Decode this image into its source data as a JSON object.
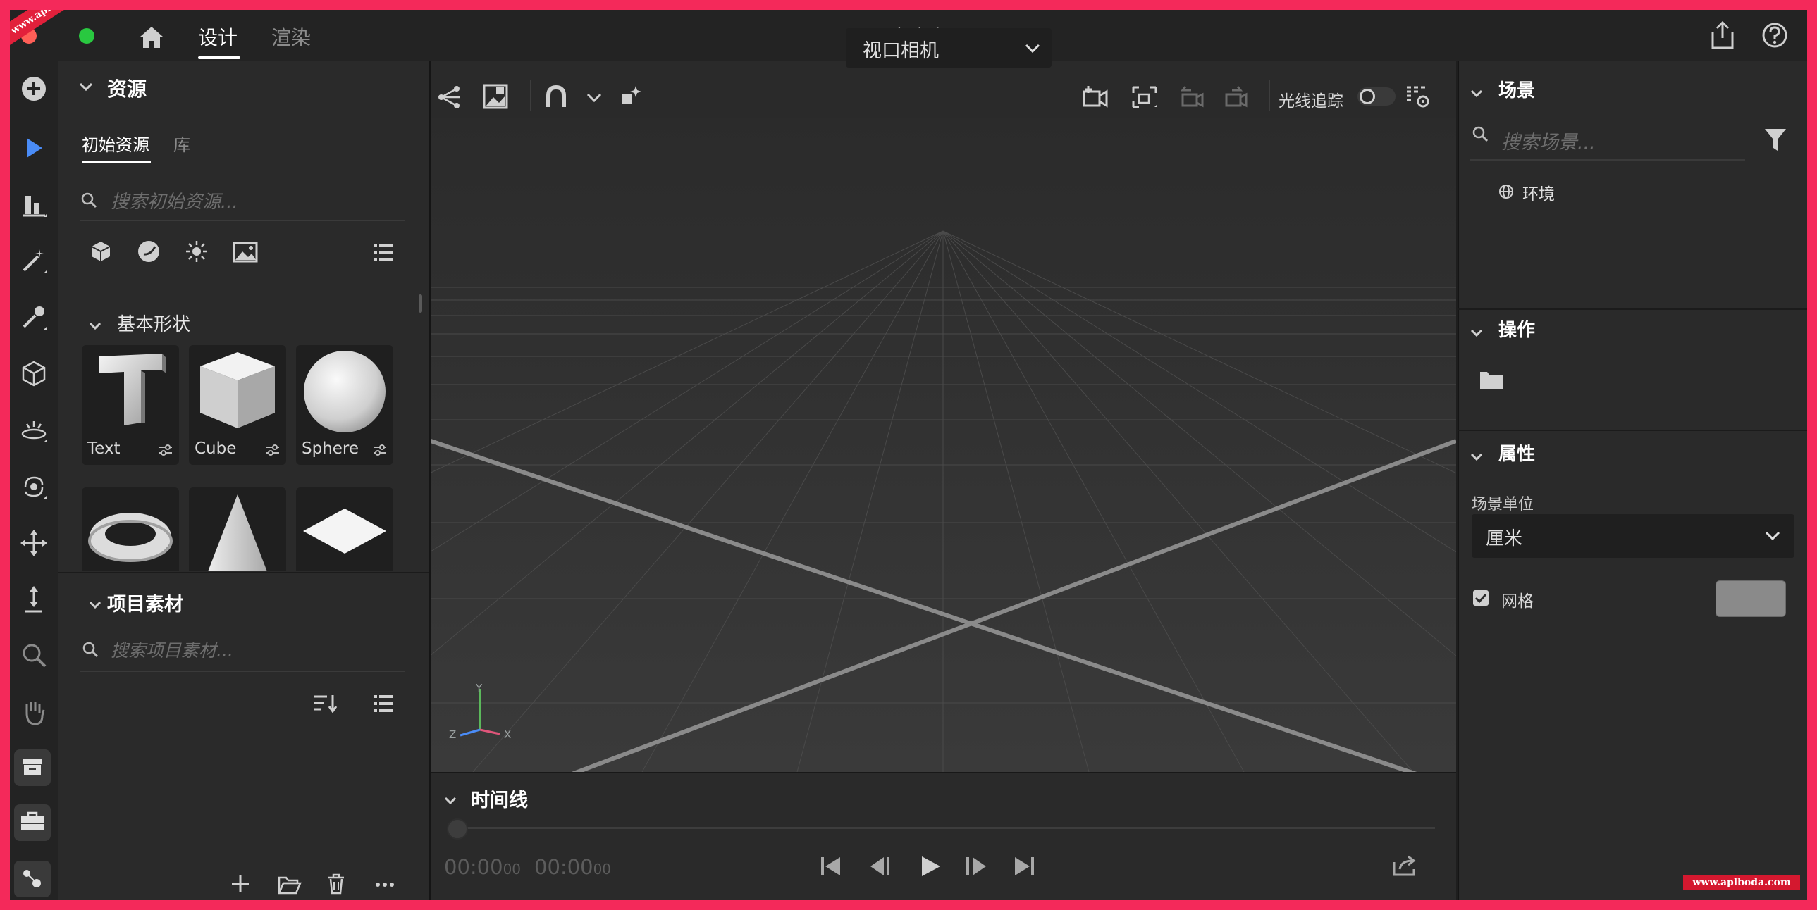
{
  "app": {
    "document_title": "未命名"
  },
  "header": {
    "tabs": [
      {
        "label": "设计",
        "active": true
      },
      {
        "label": "渲染",
        "active": false
      }
    ]
  },
  "assets_panel": {
    "title": "资源",
    "sub_tabs": [
      {
        "label": "初始资源",
        "active": true
      },
      {
        "label": "库",
        "active": false
      }
    ],
    "search_placeholder": "搜索初始资源...",
    "basic_shapes_title": "基本形状",
    "shapes": [
      {
        "label": "Text",
        "icon": "text-shape-icon"
      },
      {
        "label": "Cube",
        "icon": "cube-shape-icon"
      },
      {
        "label": "Sphere",
        "icon": "sphere-shape-icon"
      },
      {
        "label": "",
        "icon": "torus-shape-icon"
      },
      {
        "label": "",
        "icon": "cone-shape-icon"
      },
      {
        "label": "",
        "icon": "plane-shape-icon"
      }
    ]
  },
  "project_panel": {
    "title": "项目素材",
    "search_placeholder": "搜索项目素材..."
  },
  "viewport": {
    "camera_select": "视口相机",
    "raytrace_label": "光线追踪",
    "raytrace_on": false,
    "axis_labels": {
      "x": "X",
      "y": "Y",
      "z": "Z"
    }
  },
  "timeline": {
    "title": "时间线",
    "current_time": "00:00",
    "current_frames": "00",
    "total_time": "00:00",
    "total_frames": "00",
    "progress": 0
  },
  "scene_panel": {
    "title": "场景",
    "search_placeholder": "搜索场景...",
    "items": [
      {
        "label": "环境",
        "icon": "globe-icon"
      }
    ]
  },
  "actions_panel": {
    "title": "操作"
  },
  "properties_panel": {
    "title": "属性",
    "unit_label": "场景单位",
    "unit_value": "厘米",
    "grid_label": "网格",
    "grid_checked": true,
    "grid_color": "#8a8a8a"
  },
  "watermark": {
    "top_left": "www.aplboda.com",
    "bottom_right": "www.aplboda.com"
  },
  "colors": {
    "accent": "#4a8cf7",
    "brand_frame": "#f4295a"
  }
}
